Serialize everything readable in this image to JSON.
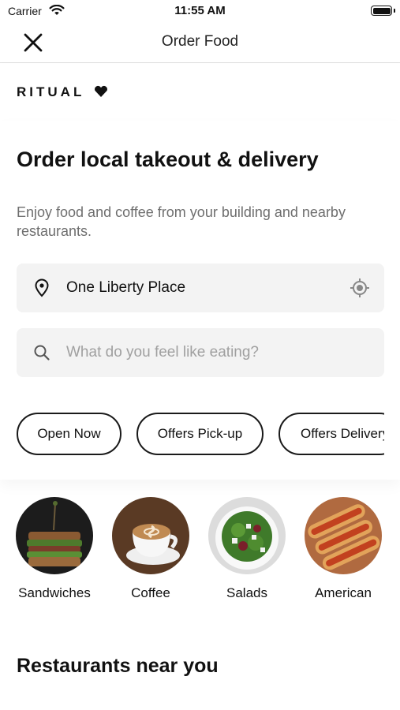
{
  "status_bar": {
    "carrier": "Carrier",
    "time": "11:55 AM"
  },
  "nav": {
    "title": "Order Food",
    "close_icon": "close-icon"
  },
  "brand": {
    "name": "RITUAL",
    "mark_icon": "heart-icon"
  },
  "hero": {
    "title": "Order local takeout & delivery",
    "subtitle": "Enjoy food and coffee from your building and nearby restaurants."
  },
  "location": {
    "value": "One Liberty Place",
    "pin_icon": "location-pin-icon",
    "locate_icon": "crosshair-icon"
  },
  "search": {
    "placeholder": "What do you feel like eating?",
    "icon": "search-icon"
  },
  "filters": [
    {
      "label": "Open Now"
    },
    {
      "label": "Offers Pick-up"
    },
    {
      "label": "Offers Delivery"
    }
  ],
  "categories": [
    {
      "label": "Sandwiches"
    },
    {
      "label": "Coffee"
    },
    {
      "label": "Salads"
    },
    {
      "label": "American"
    }
  ],
  "restaurants_section": {
    "title": "Restaurants near you"
  },
  "colors": {
    "text": "#111111",
    "muted": "#6e6e6e",
    "field_bg": "#f3f3f3",
    "placeholder": "#a0a0a0"
  }
}
